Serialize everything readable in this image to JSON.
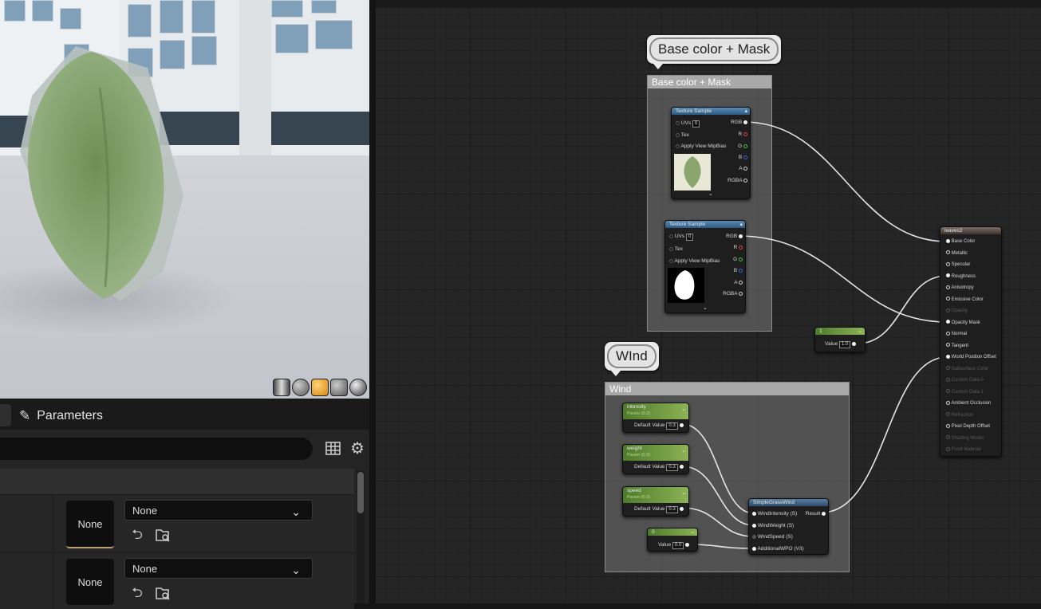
{
  "details": {
    "tab_label": "Parameters",
    "rows": [
      {
        "thumb_label": "None",
        "combo_value": "None"
      },
      {
        "thumb_label": "None",
        "combo_value": "None"
      }
    ]
  },
  "graph": {
    "comment_base": {
      "bubble": "Base color + Mask",
      "title": "Base color + Mask"
    },
    "comment_wind": {
      "bubble": "WInd",
      "title": "Wind"
    },
    "texture_sample_1": {
      "title": "Texture Sample",
      "inputs": [
        "UVs",
        "Tex",
        "Apply View MipBias"
      ],
      "uvs_value": "0",
      "outputs": [
        "RGB",
        "R",
        "G",
        "B",
        "A",
        "RGBA"
      ]
    },
    "texture_sample_2": {
      "title": "Texture Sample",
      "inputs": [
        "UVs",
        "Tex",
        "Apply View MipBias"
      ],
      "uvs_value": "0",
      "outputs": [
        "RGB",
        "R",
        "G",
        "B",
        "A",
        "RGBA"
      ]
    },
    "scalar_constant": {
      "title": "1",
      "value_label": "Value",
      "value": "1.0"
    },
    "param_intensity": {
      "title": "intensity",
      "subtitle": "Param (0.3)",
      "value_label": "Default Value",
      "value": "0.3"
    },
    "param_weight": {
      "title": "weight",
      "subtitle": "Param (0.3)",
      "value_label": "Default Value",
      "value": "0.3"
    },
    "param_speed": {
      "title": "speed",
      "subtitle": "Param (0.3)",
      "value_label": "Default Value",
      "value": "0.3"
    },
    "constant_zero": {
      "title": "0",
      "value_label": "Value",
      "value": "0.0"
    },
    "simple_grass_wind": {
      "title": "SimpleGrassWind",
      "inputs": [
        "WindIntensity (S)",
        "WindWeight (S)",
        "WindSpeed (S)",
        "AdditionalWPO (V3)"
      ],
      "output": "Result"
    },
    "result_node": {
      "title": "leaves2",
      "pins": [
        {
          "label": "Base Color",
          "enabled": true
        },
        {
          "label": "Metallic",
          "enabled": true
        },
        {
          "label": "Specular",
          "enabled": true
        },
        {
          "label": "Roughness",
          "enabled": true
        },
        {
          "label": "Anisotropy",
          "enabled": true
        },
        {
          "label": "Emissive Color",
          "enabled": true
        },
        {
          "label": "Opacity",
          "enabled": false
        },
        {
          "label": "Opacity Mask",
          "enabled": true
        },
        {
          "label": "Normal",
          "enabled": true
        },
        {
          "label": "Tangent",
          "enabled": true
        },
        {
          "label": "World Position Offset",
          "enabled": true
        },
        {
          "label": "Subsurface Color",
          "enabled": false
        },
        {
          "label": "Custom Data 0",
          "enabled": false
        },
        {
          "label": "Custom Data 1",
          "enabled": false
        },
        {
          "label": "Ambient Occlusion",
          "enabled": true
        },
        {
          "label": "Refraction",
          "enabled": false
        },
        {
          "label": "Pixel Depth Offset",
          "enabled": true
        },
        {
          "label": "Shading Model",
          "enabled": false
        },
        {
          "label": "Front Material",
          "enabled": false
        }
      ]
    }
  }
}
